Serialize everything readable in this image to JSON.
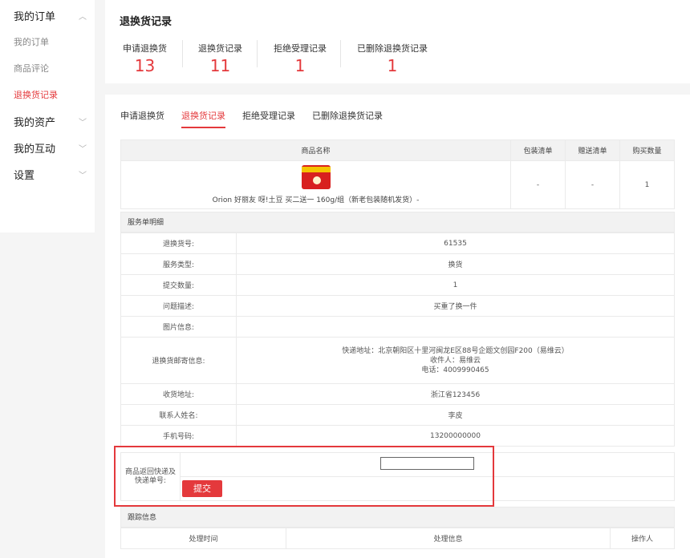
{
  "sidebar": {
    "groups": [
      {
        "label": "我的订单",
        "chevron": "︿",
        "items": [
          "我的订单",
          "商品评论",
          "退换货记录"
        ]
      },
      {
        "label": "我的资产",
        "chevron": "﹀"
      },
      {
        "label": "我的互动",
        "chevron": "﹀"
      },
      {
        "label": "设置",
        "chevron": "﹀"
      }
    ]
  },
  "header": {
    "title": "退换货记录",
    "stats": [
      {
        "label": "申请退换货",
        "value": "13"
      },
      {
        "label": "退换货记录",
        "value": "11"
      },
      {
        "label": "拒绝受理记录",
        "value": "1"
      },
      {
        "label": "已删除退换货记录",
        "value": "1"
      }
    ]
  },
  "tabs": [
    "申请退换货",
    "退换货记录",
    "拒绝受理记录",
    "已删除退换货记录"
  ],
  "product_table": {
    "headers": [
      "商品名称",
      "包装清单",
      "赠送清单",
      "购买数量"
    ],
    "row": {
      "name": "Orion 好丽友 呀!土豆 买二送一 160g/组（新老包装随机发货）-",
      "packing": "-",
      "gift": "-",
      "qty": "1"
    }
  },
  "service": {
    "header": "服务单明细",
    "rows": [
      {
        "key": "退换货号:",
        "value": "61535"
      },
      {
        "key": "服务类型:",
        "value": "换货"
      },
      {
        "key": "提交数量:",
        "value": "1"
      },
      {
        "key": "问题描述:",
        "value": "买重了换一件"
      },
      {
        "key": "图片信息:",
        "value": ""
      }
    ],
    "mail": {
      "key": "退换货邮寄信息:",
      "line1": "快递地址：北京朝阳区十里河闽龙E区88号企题文创园F200（易维云）",
      "line2": "收件人：易维云",
      "line3": "电话：4009990465"
    },
    "rows2": [
      {
        "key": "收货地址:",
        "value": "浙江省123456"
      },
      {
        "key": "联系人姓名:",
        "value": "李皮"
      },
      {
        "key": "手机号码:",
        "value": "13200000000"
      }
    ]
  },
  "submit": {
    "label_line1": "商品返回快递及",
    "label_line2": "快递单号:",
    "input_value": "",
    "button": "提交"
  },
  "tracking": {
    "header": "跟踪信息",
    "columns": [
      "处理时间",
      "处理信息",
      "操作人"
    ]
  },
  "colors": {
    "accent": "#e4393c"
  }
}
